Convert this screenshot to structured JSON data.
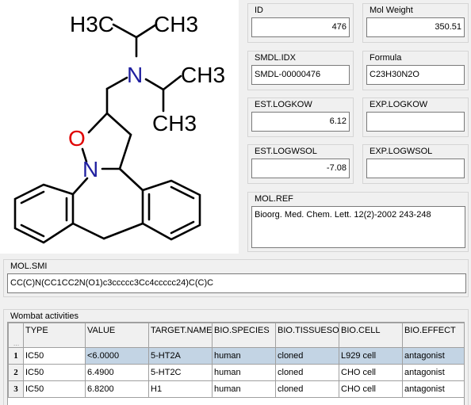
{
  "molecule": {
    "atoms": {
      "h3c_left": "H3C",
      "ch3_top": "CH3",
      "n_amine": "N",
      "ch3_right_upper": "CH3",
      "ch3_right_lower": "CH3",
      "o": "O",
      "n_ring": "N"
    },
    "colors": {
      "nitrogen": "#1f1f9f",
      "oxygen": "#e00000",
      "bond": "#000000"
    }
  },
  "fields": {
    "id": {
      "label": "ID",
      "value": "476"
    },
    "mol_weight": {
      "label": "Mol Weight",
      "value": "350.51"
    },
    "smdl_idx": {
      "label": "SMDL.IDX",
      "value": "SMDL-00000476"
    },
    "formula": {
      "label": "Formula",
      "value": "C23H30N2O"
    },
    "est_logkow": {
      "label": "EST.LOGKOW",
      "value": "6.12"
    },
    "exp_logkow": {
      "label": "EXP.LOGKOW",
      "value": ""
    },
    "est_logwsol": {
      "label": "EST.LOGWSOL",
      "value": "-7.08"
    },
    "exp_logwsol": {
      "label": "EXP.LOGWSOL",
      "value": ""
    },
    "mol_ref": {
      "label": "MOL.REF",
      "value": "Bioorg. Med. Chem. Lett. 12(2)-2002 243-248"
    },
    "mol_smi": {
      "label": "MOL.SMI",
      "value": "CC(C)N(CC1CC2N(O1)c3ccccc3Cc4ccccc24)C(C)C"
    }
  },
  "wombat": {
    "label": "Wombat activities",
    "corner": ". . .",
    "columns": [
      "TYPE",
      "VALUE",
      "TARGET.NAME",
      "BIO.SPECIES",
      "BIO.TISSUESOU",
      "BIO.CELL",
      "BIO.EFFECT"
    ],
    "rows": [
      {
        "num": "1",
        "type": "IC50",
        "value": "<6.0000",
        "target": "5-HT2A",
        "species": "human",
        "tissue": "cloned",
        "cell": "L929 cell",
        "effect": "antagonist",
        "selected": true
      },
      {
        "num": "2",
        "type": "IC50",
        "value": "6.4900",
        "target": "5-HT2C",
        "species": "human",
        "tissue": "cloned",
        "cell": "CHO cell",
        "effect": "antagonist",
        "selected": false
      },
      {
        "num": "3",
        "type": "IC50",
        "value": "6.8200",
        "target": "H1",
        "species": "human",
        "tissue": "cloned",
        "cell": "CHO cell",
        "effect": "antagonist",
        "selected": false
      }
    ],
    "selection_color": "#c3d4e4"
  }
}
